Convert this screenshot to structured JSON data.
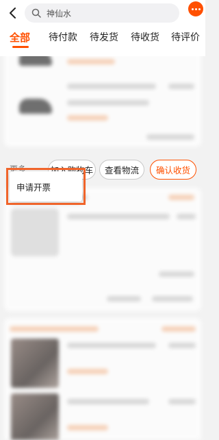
{
  "search": {
    "query": "神仙水",
    "icon": "search-icon"
  },
  "header": {
    "back_icon": "chevron-left-icon",
    "more_icon": "more-dots-icon"
  },
  "tabs": [
    {
      "label": "全部",
      "active": true
    },
    {
      "label": "待付款",
      "active": false
    },
    {
      "label": "待发货",
      "active": false
    },
    {
      "label": "待收货",
      "active": false
    },
    {
      "label": "待评价",
      "active": false
    }
  ],
  "actions": {
    "more_label": "更多",
    "add_to_cart": "加入购物车",
    "view_logistics": "查看物流",
    "confirm_receipt": "确认收货"
  },
  "popup": {
    "invoice": "申请开票"
  },
  "colors": {
    "accent": "#ff5000",
    "highlight": "#f0642a",
    "background": "#f2f2f2"
  }
}
